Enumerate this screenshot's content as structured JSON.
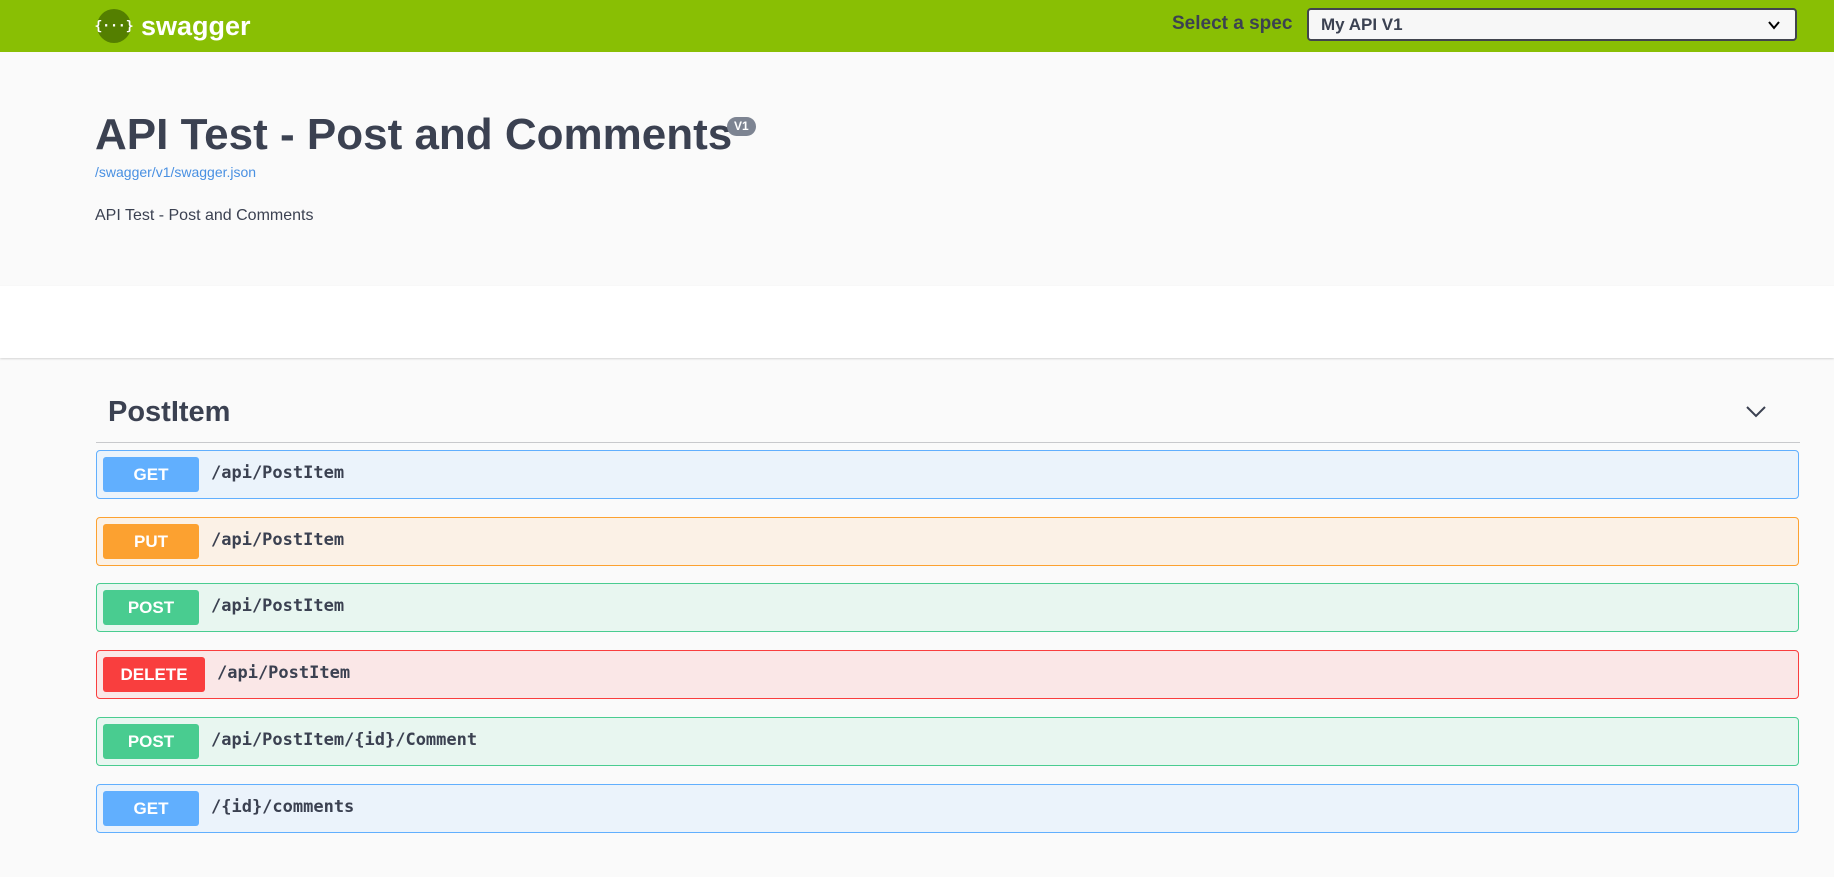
{
  "topbar": {
    "logo_text": "swagger",
    "logo_glyph": "{···}",
    "spec_label": "Select a spec",
    "spec_selected": "My API V1"
  },
  "info": {
    "title": "API Test - Post and Comments",
    "version": "V1",
    "spec_url": "/swagger/v1/swagger.json",
    "description": "API Test - Post and Comments"
  },
  "tag": {
    "name": "PostItem"
  },
  "operations": [
    {
      "method": "GET",
      "path": "/api/PostItem"
    },
    {
      "method": "PUT",
      "path": "/api/PostItem"
    },
    {
      "method": "POST",
      "path": "/api/PostItem"
    },
    {
      "method": "DELETE",
      "path": "/api/PostItem"
    },
    {
      "method": "POST",
      "path": "/api/PostItem/{id}/Comment"
    },
    {
      "method": "GET",
      "path": "/{id}/comments"
    }
  ],
  "colors": {
    "topbar": "#89bf04",
    "get": "#61affe",
    "put": "#fca130",
    "post": "#49cc90",
    "delete": "#f93e3e"
  }
}
